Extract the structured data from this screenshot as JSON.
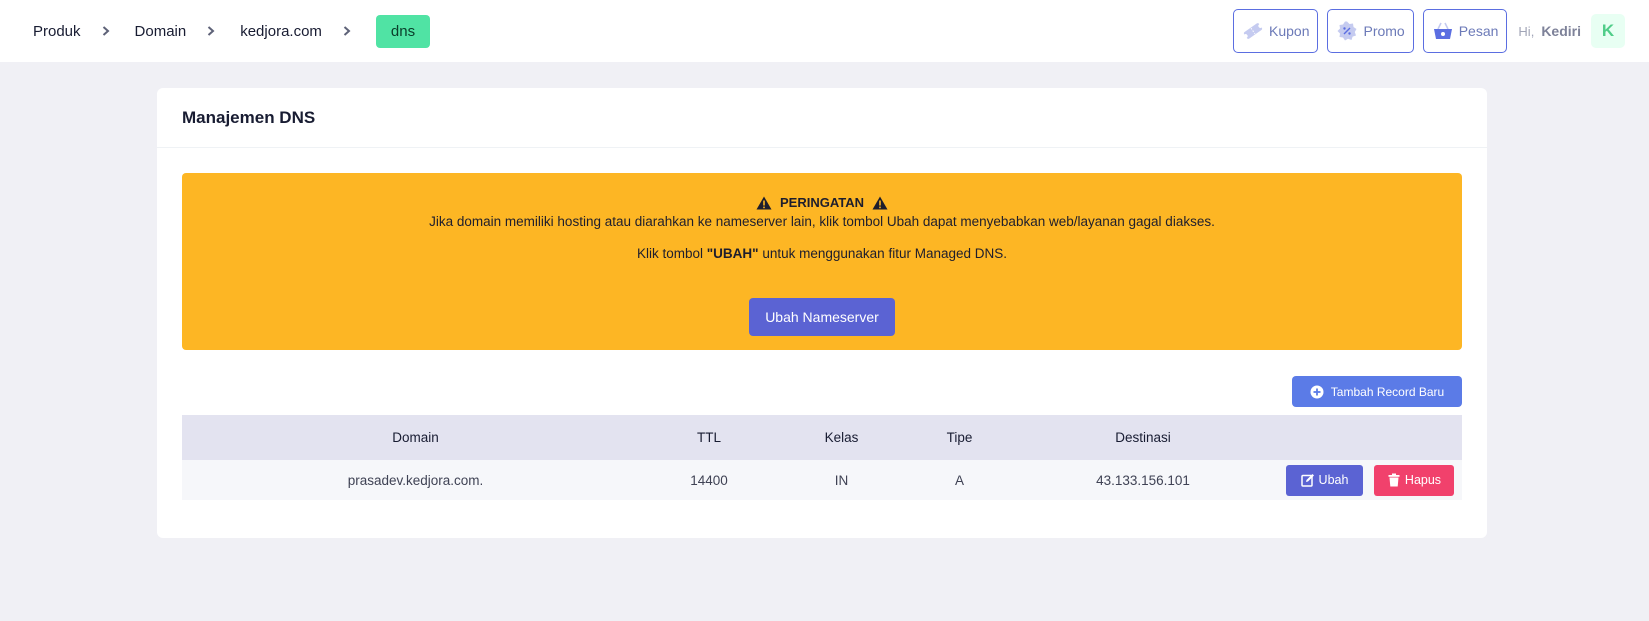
{
  "breadcrumb": {
    "items": [
      "Produk",
      "Domain",
      "kedjora.com"
    ],
    "active": "dns"
  },
  "header": {
    "kupon": "Kupon",
    "promo": "Promo",
    "pesan": "Pesan",
    "greeting": "Hi,",
    "username": "Kediri",
    "avatar_initial": "K"
  },
  "card": {
    "title": "Manajemen DNS"
  },
  "warning": {
    "title": "PERINGATAN",
    "line1": "Jika domain memiliki hosting atau diarahkan ke nameserver lain, klik tombol Ubah dapat menyebabkan web/layanan gagal diakses.",
    "line2_prefix": "Klik tombol ",
    "line2_bold": "\"UBAH\"",
    "line2_suffix": " untuk menggunakan fitur Managed DNS.",
    "button": "Ubah Nameserver"
  },
  "add_record_button": "Tambah Record Baru",
  "table": {
    "headers": [
      "Domain",
      "TTL",
      "Kelas",
      "Tipe",
      "Destinasi",
      ""
    ],
    "rows": [
      {
        "domain": "prasadev.kedjora.com.",
        "ttl": "14400",
        "kelas": "IN",
        "tipe": "A",
        "destinasi": "43.133.156.101",
        "edit_label": "Ubah",
        "delete_label": "Hapus"
      }
    ]
  },
  "colors": {
    "accent": "#5b63d3",
    "active_crumb": "#50e3a4",
    "warning_bg": "#fdb624",
    "danger": "#f1416c"
  }
}
